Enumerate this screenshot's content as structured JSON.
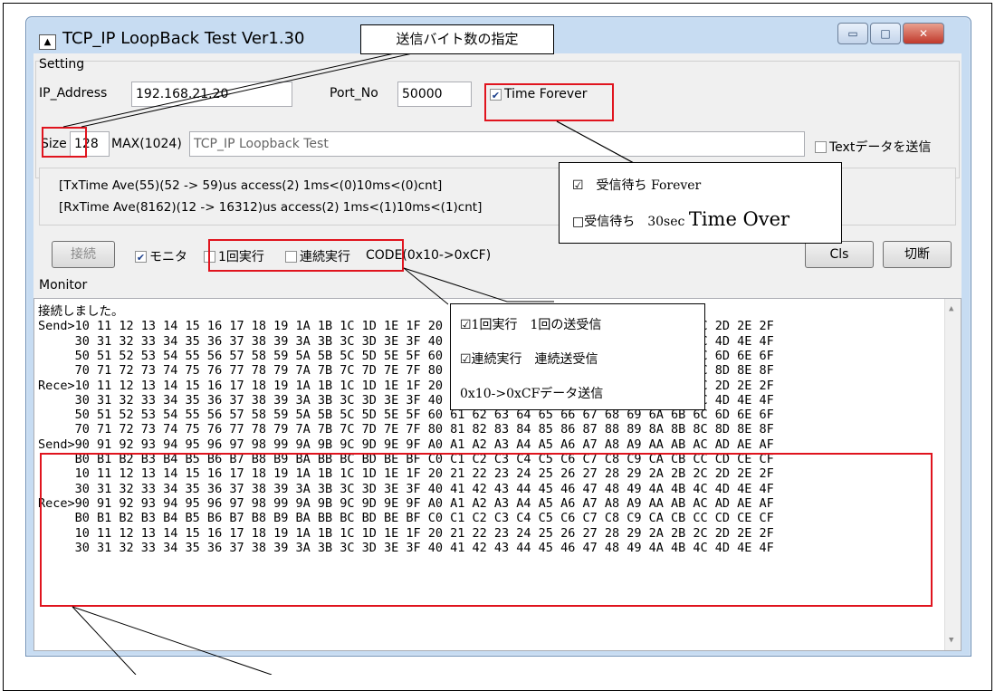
{
  "window": {
    "title": "TCP_IP LoopBack Test Ver1.30",
    "icon": "app-icon",
    "min_glyph": "▭",
    "max_glyph": "□",
    "close_glyph": "✕"
  },
  "setting": {
    "group_label": "Setting",
    "ip_label": "IP_Address",
    "ip_value": "192.168.21.20",
    "port_label": "Port_No",
    "port_value": "50000",
    "time_forever_label": "Time Forever",
    "time_forever_checked": true,
    "size_label": "Size",
    "size_value": "128",
    "max_label": "MAX(1024)",
    "text_value": "TCP_IP Loopback Test",
    "text_send_label": "Textデータを送信",
    "text_send_checked": false
  },
  "stats": {
    "tx": "[TxTime Ave(55)(52 -> 59)us access(2) 1ms<(0)10ms<(0)cnt]",
    "rx": "[RxTime Ave(8162)(12 -> 16312)us access(2) 1ms<(1)10ms<(1)cnt]"
  },
  "controls": {
    "connect_label": "接続",
    "monitor_label": "モニタ",
    "monitor_checked": true,
    "once_label": "1回実行",
    "once_checked": false,
    "continuous_label": "連続実行",
    "continuous_checked": false,
    "code_label": "CODE(0x10->0xCF)",
    "cls_label": "Cls",
    "disconnect_label": "切断"
  },
  "monitor": {
    "label": "Monitor",
    "lines": [
      "接続しました。",
      "Send>10 11 12 13 14 15 16 17 18 19 1A 1B 1C 1D 1E 1F 20 21 22 23 24 25 26 27 28 29 2A 2B 2C 2D 2E 2F",
      "     30 31 32 33 34 35 36 37 38 39 3A 3B 3C 3D 3E 3F 40 41 42 43 44 45 46 47 48 49 4A 4B 4C 4D 4E 4F",
      "     50 51 52 53 54 55 56 57 58 59 5A 5B 5C 5D 5E 5F 60 61 62 63 64 65 66 67 68 69 6A 6B 6C 6D 6E 6F",
      "     70 71 72 73 74 75 76 77 78 79 7A 7B 7C 7D 7E 7F 80 81 82 83 84 85 86 87 88 89 8A 8B 8C 8D 8E 8F",
      "Rece>10 11 12 13 14 15 16 17 18 19 1A 1B 1C 1D 1E 1F 20 21 22 23 24 25 26 27 28 29 2A 2B 2C 2D 2E 2F",
      "     30 31 32 33 34 35 36 37 38 39 3A 3B 3C 3D 3E 3F 40 41 42 43 44 45 46 47 48 49 4A 4B 4C 4D 4E 4F",
      "     50 51 52 53 54 55 56 57 58 59 5A 5B 5C 5D 5E 5F 60 61 62 63 64 65 66 67 68 69 6A 6B 6C 6D 6E 6F",
      "     70 71 72 73 74 75 76 77 78 79 7A 7B 7C 7D 7E 7F 80 81 82 83 84 85 86 87 88 89 8A 8B 8C 8D 8E 8F",
      "Send>90 91 92 93 94 95 96 97 98 99 9A 9B 9C 9D 9E 9F A0 A1 A2 A3 A4 A5 A6 A7 A8 A9 AA AB AC AD AE AF",
      "     B0 B1 B2 B3 B4 B5 B6 B7 B8 B9 BA BB BC BD BE BF C0 C1 C2 C3 C4 C5 C6 C7 C8 C9 CA CB CC CD CE CF",
      "     10 11 12 13 14 15 16 17 18 19 1A 1B 1C 1D 1E 1F 20 21 22 23 24 25 26 27 28 29 2A 2B 2C 2D 2E 2F",
      "     30 31 32 33 34 35 36 37 38 39 3A 3B 3C 3D 3E 3F 40 41 42 43 44 45 46 47 48 49 4A 4B 4C 4D 4E 4F",
      "Rece>90 91 92 93 94 95 96 97 98 99 9A 9B 9C 9D 9E 9F A0 A1 A2 A3 A4 A5 A6 A7 A8 A9 AA AB AC AD AE AF",
      "     B0 B1 B2 B3 B4 B5 B6 B7 B8 B9 BA BB BC BD BE BF C0 C1 C2 C3 C4 C5 C6 C7 C8 C9 CA CB CC CD CE CF",
      "     10 11 12 13 14 15 16 17 18 19 1A 1B 1C 1D 1E 1F 20 21 22 23 24 25 26 27 28 29 2A 2B 2C 2D 2E 2F",
      "     30 31 32 33 34 35 36 37 38 39 3A 3B 3C 3D 3E 3F 40 41 42 43 44 45 46 47 48 49 4A 4B 4C 4D 4E 4F"
    ]
  },
  "annotations": {
    "size_note": "送信バイト数の指定",
    "forever_line1": "☑　受信待ち Forever",
    "forever_line2a": "□受信待ち　30sec",
    "forever_line2b": "Time Over",
    "exec_line1": "☑1回実行　1回の送受信",
    "exec_line2": "☑連続実行　連続送受信",
    "exec_line3": "0x10->0xCFデータ送信"
  },
  "colors": {
    "highlight": "#e0141e",
    "window_frame": "#c7dcf2",
    "client_bg": "#f0f0f0"
  }
}
